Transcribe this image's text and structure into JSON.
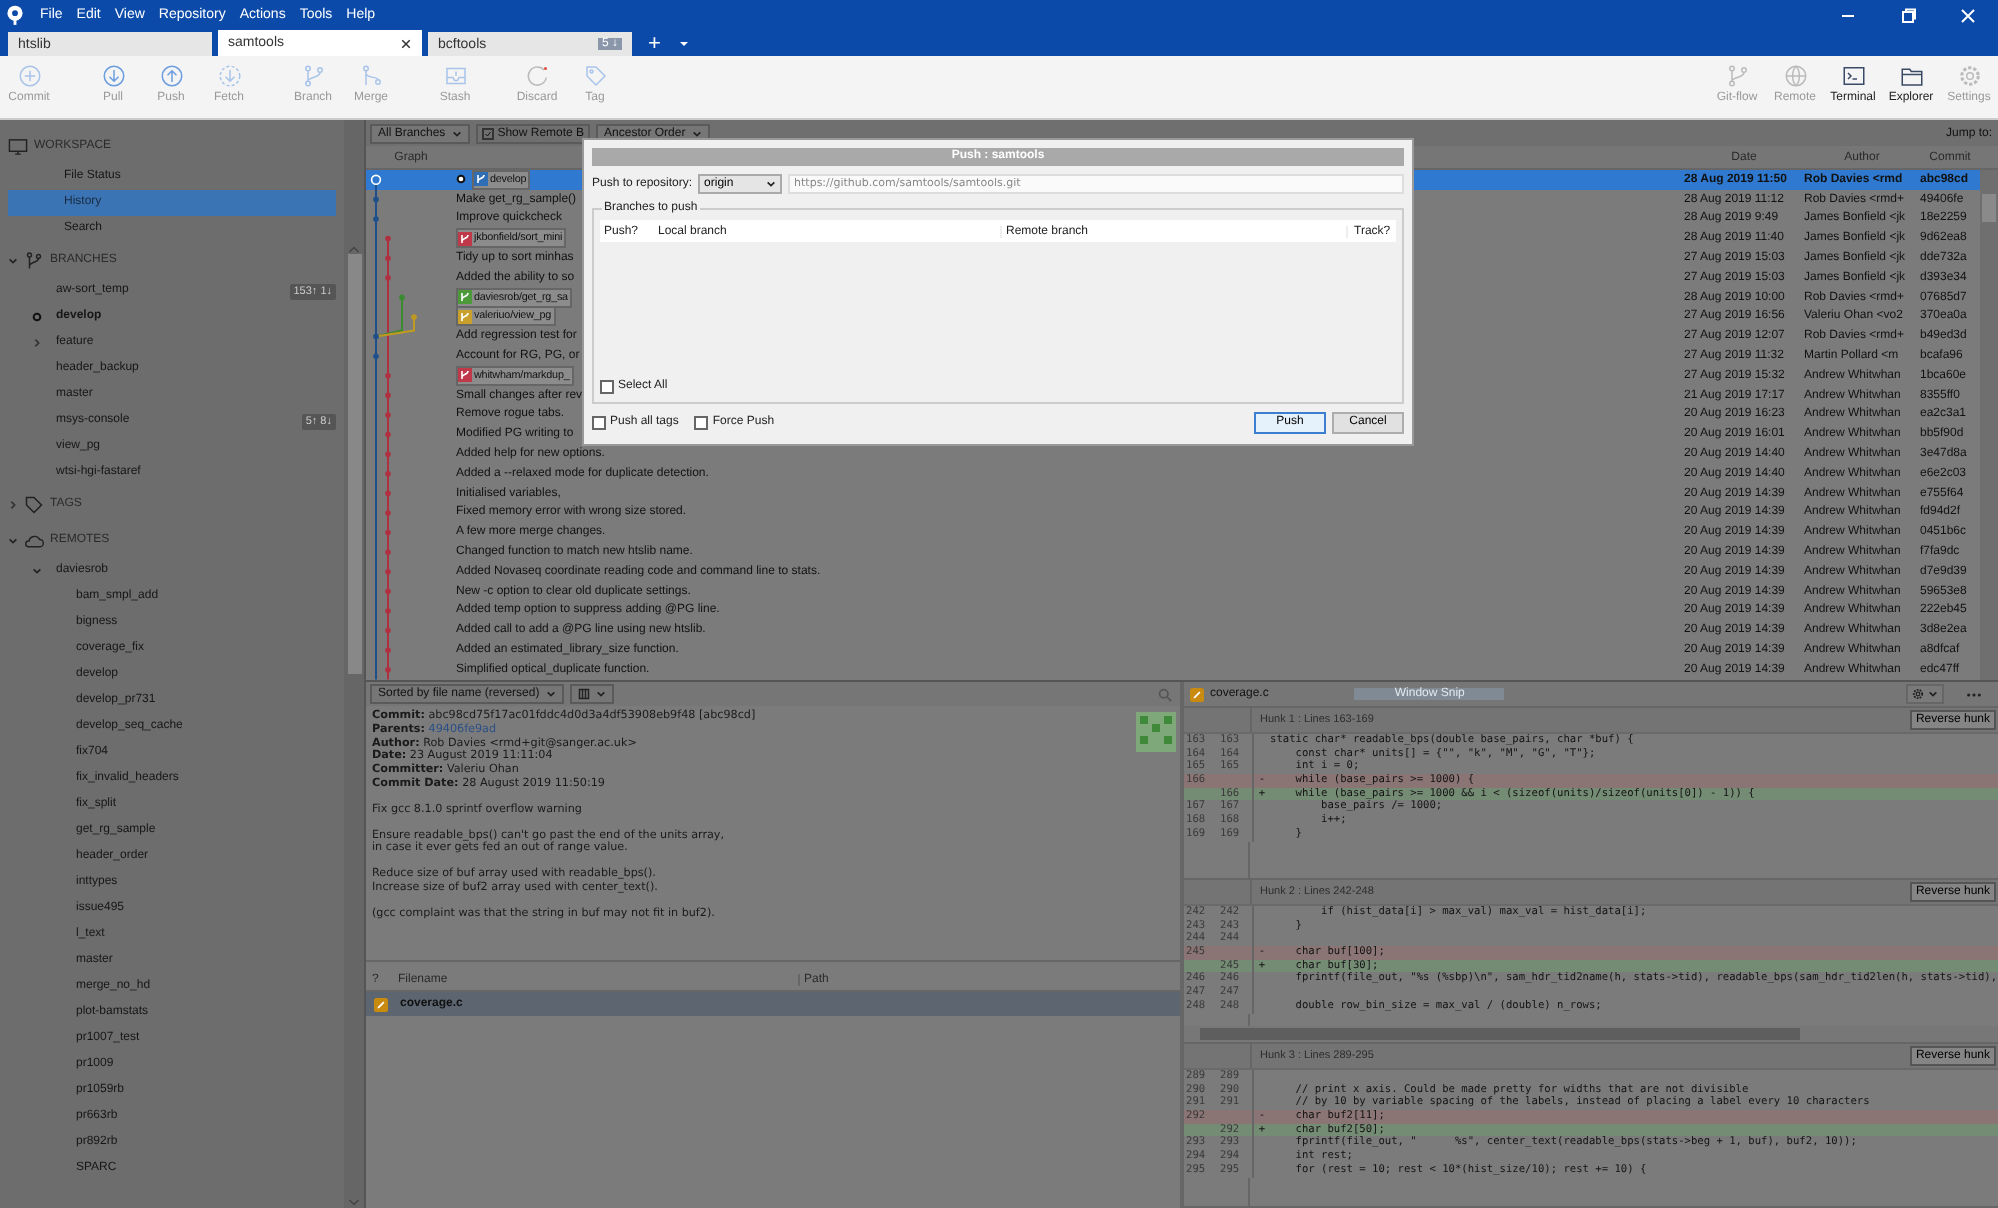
{
  "menu": [
    "File",
    "Edit",
    "View",
    "Repository",
    "Actions",
    "Tools",
    "Help"
  ],
  "tabs": [
    {
      "label": "htslib",
      "selected": false
    },
    {
      "label": "samtools",
      "selected": true
    },
    {
      "label": "bcftools",
      "selected": false,
      "badge": "5 ↓"
    }
  ],
  "new_tab": "+",
  "toolbar": {
    "left": [
      {
        "kind": "commit",
        "label": "Commit"
      },
      {
        "kind": "pull",
        "label": "Pull"
      },
      {
        "kind": "push",
        "label": "Push"
      },
      {
        "kind": "fetch",
        "label": "Fetch"
      },
      {
        "kind": "branch",
        "label": "Branch"
      },
      {
        "kind": "merge",
        "label": "Merge"
      },
      {
        "kind": "stash",
        "label": "Stash"
      },
      {
        "kind": "discard",
        "label": "Discard"
      },
      {
        "kind": "tag",
        "label": "Tag"
      }
    ],
    "right": [
      {
        "kind": "gitflow",
        "label": "Git-flow",
        "enabled": false
      },
      {
        "kind": "remote",
        "label": "Remote",
        "enabled": false
      },
      {
        "kind": "terminal",
        "label": "Terminal",
        "enabled": true
      },
      {
        "kind": "explorer",
        "label": "Explorer",
        "enabled": true
      },
      {
        "kind": "settings",
        "label": "Settings",
        "enabled": false
      }
    ]
  },
  "sidebar": {
    "workspace": {
      "title": "WORKSPACE",
      "items": [
        {
          "label": "File Status",
          "selected": false
        },
        {
          "label": "History",
          "selected": true
        },
        {
          "label": "Search",
          "selected": false
        }
      ]
    },
    "branches": {
      "title": "BRANCHES",
      "expanded": true,
      "items": [
        {
          "kind": "branch",
          "label": "aw-sort_temp",
          "current": false,
          "badge": "153↑ 1↓"
        },
        {
          "kind": "branch",
          "label": "develop",
          "current": true
        },
        {
          "kind": "folder",
          "label": "feature",
          "current": false,
          "expanded": false
        },
        {
          "kind": "branch",
          "label": "header_backup",
          "current": false
        },
        {
          "kind": "branch",
          "label": "master",
          "current": false
        },
        {
          "kind": "branch",
          "label": "msys-console",
          "current": false,
          "badge": "5↑ 8↓"
        },
        {
          "kind": "branch",
          "label": "view_pg",
          "current": false
        },
        {
          "kind": "branch",
          "label": "wtsi-hgi-fastaref",
          "current": false
        }
      ]
    },
    "tags": {
      "title": "TAGS",
      "expanded": false
    },
    "remotes": {
      "title": "REMOTES",
      "expanded": true,
      "children": [
        {
          "label": "daviesrob",
          "expanded": true,
          "children": [
            {
              "label": "bam_smpl_add"
            },
            {
              "label": "bigness"
            },
            {
              "label": "coverage_fix"
            },
            {
              "label": "develop"
            },
            {
              "label": "develop_pr731"
            },
            {
              "label": "develop_seq_cache"
            },
            {
              "label": "fix704"
            },
            {
              "label": "fix_invalid_headers"
            },
            {
              "label": "fix_split"
            },
            {
              "label": "get_rg_sample"
            },
            {
              "label": "header_order"
            },
            {
              "label": "inttypes"
            },
            {
              "label": "issue495"
            },
            {
              "label": "l_text"
            },
            {
              "label": "master"
            },
            {
              "label": "merge_no_hd"
            },
            {
              "label": "plot-bamstats"
            },
            {
              "label": "pr1007_test"
            },
            {
              "label": "pr1009"
            },
            {
              "label": "pr1059rb"
            },
            {
              "label": "pr663rb"
            },
            {
              "label": "pr892rb"
            },
            {
              "label": "SPARC"
            }
          ]
        }
      ]
    }
  },
  "history": {
    "branch_filter": "All Branches",
    "show_remote": {
      "label": "Show Remote B",
      "checked": true
    },
    "order": "Ancestor Order",
    "jump_to": "Jump to:",
    "columns": [
      "Graph",
      "Date",
      "Author",
      "Commit"
    ],
    "rows": [
      {
        "selected": true,
        "head": true,
        "labels": [
          {
            "text": "develop",
            "color": "#2f6db5"
          }
        ],
        "date": "28 Aug 2019 11:50",
        "author": "Rob Davies <rmd",
        "commit": "abc98cd"
      },
      {
        "selected": false,
        "message": "Make get_rg_sample()",
        "date": "28 Aug 2019 11:12",
        "author": "Rob Davies <rmd+",
        "commit": "49406fe"
      },
      {
        "selected": false,
        "message": "Improve quickcheck",
        "date": "28 Aug 2019 9:49",
        "author": "James Bonfield <jk",
        "commit": "18e2259"
      },
      {
        "selected": false,
        "labels": [
          {
            "text": "jkbonfield/sort_mini",
            "color": "#c0394b"
          }
        ],
        "date": "28 Aug 2019 11:40",
        "author": "James Bonfield <jk",
        "commit": "9d62ea8"
      },
      {
        "selected": false,
        "message": "Tidy up to sort minhas",
        "date": "27 Aug 2019 15:03",
        "author": "James Bonfield <jk",
        "commit": "dde732a"
      },
      {
        "selected": false,
        "message": "Added the ability to so",
        "date": "27 Aug 2019 15:03",
        "author": "James Bonfield <jk",
        "commit": "d393e34"
      },
      {
        "selected": false,
        "labels": [
          {
            "text": "daviesrob/get_rg_sa",
            "color": "#4d9a3a"
          }
        ],
        "date": "28 Aug 2019 10:00",
        "author": "Rob Davies <rmd+",
        "commit": "07685d7"
      },
      {
        "selected": false,
        "labels": [
          {
            "text": "valeriuo/view_pg",
            "color": "#c9a02c"
          }
        ],
        "date": "27 Aug 2019 16:56",
        "author": "Valeriu Ohan <vo2",
        "commit": "370ea0a"
      },
      {
        "selected": false,
        "message": "Add regression test for",
        "date": "27 Aug 2019 12:07",
        "author": "Rob Davies <rmd+",
        "commit": "b49ed3d"
      },
      {
        "selected": false,
        "message": "Account for RG, PG, or",
        "date": "27 Aug 2019 11:32",
        "author": "Martin Pollard <m",
        "commit": "bcafa96"
      },
      {
        "selected": false,
        "labels": [
          {
            "text": "whitwham/markdup_",
            "color": "#c0394b"
          }
        ],
        "date": "27 Aug 2019 15:32",
        "author": "Andrew Whitwhan",
        "commit": "1bca60e"
      },
      {
        "selected": false,
        "message": "Small changes after rev",
        "date": "21 Aug 2019 17:17",
        "author": "Andrew Whitwhan",
        "commit": "8355ff0"
      },
      {
        "selected": false,
        "message": "Remove rogue tabs.",
        "date": "20 Aug 2019 16:23",
        "author": "Andrew Whitwhan",
        "commit": "ea2c3a1"
      },
      {
        "selected": false,
        "message": "Modified PG writing to",
        "date": "20 Aug 2019 16:01",
        "author": "Andrew Whitwhan",
        "commit": "bb5f90d"
      },
      {
        "selected": false,
        "message": "Added help for new options.",
        "date": "20 Aug 2019 14:40",
        "author": "Andrew Whitwhan",
        "commit": "3e47d8a"
      },
      {
        "selected": false,
        "message": "Added a --relaxed mode for duplicate detection.",
        "date": "20 Aug 2019 14:40",
        "author": "Andrew Whitwhan",
        "commit": "e6e2c03"
      },
      {
        "selected": false,
        "message": "Initialised variables,",
        "date": "20 Aug 2019 14:39",
        "author": "Andrew Whitwhan",
        "commit": "e755f64"
      },
      {
        "selected": false,
        "message": "Fixed memory error with wrong size stored.",
        "date": "20 Aug 2019 14:39",
        "author": "Andrew Whitwhan",
        "commit": "fd94d2f"
      },
      {
        "selected": false,
        "message": "A few more merge changes.",
        "date": "20 Aug 2019 14:39",
        "author": "Andrew Whitwhan",
        "commit": "0451b6c"
      },
      {
        "selected": false,
        "message": "Changed function to match new htslib name.",
        "date": "20 Aug 2019 14:39",
        "author": "Andrew Whitwhan",
        "commit": "f7fa9dc"
      },
      {
        "selected": false,
        "message": "Added Novaseq coordinate reading code and command line to stats.",
        "date": "20 Aug 2019 14:39",
        "author": "Andrew Whitwhan",
        "commit": "d7e9d39"
      },
      {
        "selected": false,
        "message": "New -c option to clear old duplicate settings.",
        "date": "20 Aug 2019 14:39",
        "author": "Andrew Whitwhan",
        "commit": "59653e8"
      },
      {
        "selected": false,
        "message": "Added temp option to suppress adding @PG line.",
        "date": "20 Aug 2019 14:39",
        "author": "Andrew Whitwhan",
        "commit": "222eb45"
      },
      {
        "selected": false,
        "message": "Added call to add a @PG line using new htslib.",
        "date": "20 Aug 2019 14:39",
        "author": "Andrew Whitwhan",
        "commit": "3d8e2ea"
      },
      {
        "selected": false,
        "message": "Added an estimated_library_size function.",
        "date": "20 Aug 2019 14:39",
        "author": "Andrew Whitwhan",
        "commit": "a8dfcaf"
      },
      {
        "selected": false,
        "message": "Simplified optical_duplicate function.",
        "date": "20 Aug 2019 14:39",
        "author": "Andrew Whitwhan",
        "commit": "edc47ff"
      }
    ]
  },
  "details": {
    "sort": "Sorted by file name (reversed)",
    "fields": [
      {
        "kind": "text",
        "label": "Commit:",
        "value": "abc98cd75f17ac01fddc4d0d3a4df53908eb9f48 [abc98cd]"
      },
      {
        "kind": "link",
        "label": "Parents:",
        "value": "49406fe9ad"
      },
      {
        "kind": "text",
        "label": "Author:",
        "value": "Rob Davies <rmd+git@sanger.ac.uk>"
      },
      {
        "kind": "text",
        "label": "Date:",
        "value": "23 August 2019 11:11:04"
      },
      {
        "kind": "text",
        "label": "Committer:",
        "value": "Valeriu Ohan"
      },
      {
        "kind": "text",
        "label": "Commit Date:",
        "value": "28 August 2019 11:50:19"
      }
    ],
    "message": [
      "Fix gcc 8.1.0 sprintf overflow warning",
      "Ensure readable_bps() can't go past the end of the units array,\nin case it ever gets fed an out of range value.",
      "Reduce size of buf array used with readable_bps().\nIncrease size of buf2 array used with center_text().",
      "(gcc complaint was that the string in buf may not fit in buf2)."
    ],
    "files": {
      "columns": [
        "?",
        "Filename",
        "Path"
      ],
      "rows": [
        {
          "name": "coverage.c",
          "selected": true
        }
      ]
    }
  },
  "diff": {
    "file": "coverage.c",
    "snip_hint": "Window Snip",
    "hunks": [
      {
        "title": "Hunk 1 : Lines 163-169",
        "button": "Reverse hunk",
        "h_scroll": false,
        "lines": [
          {
            "kind": "context",
            "old": "163",
            "new": "163",
            "code": "static char* readable_bps(double base_pairs, char *buf) {"
          },
          {
            "kind": "context",
            "old": "164",
            "new": "164",
            "code": "    const char* units[] = {\"\", \"k\", \"M\", \"G\", \"T\"};"
          },
          {
            "kind": "context",
            "old": "165",
            "new": "165",
            "code": "    int i = 0;"
          },
          {
            "kind": "removed",
            "old": "166",
            "sign": "-",
            "code": "    while (base_pairs >= 1000) {"
          },
          {
            "kind": "added",
            "new": "166",
            "sign": "+",
            "code": "    while (base_pairs >= 1000 && i < (sizeof(units)/sizeof(units[0]) - 1)) {"
          },
          {
            "kind": "context",
            "old": "167",
            "new": "167",
            "code": "        base_pairs /= 1000;"
          },
          {
            "kind": "context",
            "old": "168",
            "new": "168",
            "code": "        i++;"
          },
          {
            "kind": "context",
            "old": "169",
            "new": "169",
            "code": "    }"
          }
        ]
      },
      {
        "title": "Hunk 2 : Lines 242-248",
        "button": "Reverse hunk",
        "h_scroll": true,
        "lines": [
          {
            "kind": "context",
            "old": "242",
            "new": "242",
            "code": "        if (hist_data[i] > max_val) max_val = hist_data[i];"
          },
          {
            "kind": "context",
            "old": "243",
            "new": "243",
            "code": "    }"
          },
          {
            "kind": "context",
            "old": "244",
            "new": "244"
          },
          {
            "kind": "removed",
            "old": "245",
            "sign": "-",
            "code": "    char buf[100];"
          },
          {
            "kind": "added",
            "new": "245",
            "sign": "+",
            "code": "    char buf[30];"
          },
          {
            "kind": "context",
            "old": "246",
            "new": "246",
            "code": "    fprintf(file_out, \"%s (%sbp)\\n\", sam_hdr_tid2name(h, stats->tid), readable_bps(sam_hdr_tid2len(h, stats->tid),"
          },
          {
            "kind": "context",
            "old": "247",
            "new": "247"
          },
          {
            "kind": "context",
            "old": "248",
            "new": "248",
            "code": "    double row_bin_size = max_val / (double) n_rows;"
          }
        ]
      },
      {
        "title": "Hunk 3 : Lines 289-295",
        "button": "Reverse hunk",
        "h_scroll": false,
        "lines": [
          {
            "kind": "context",
            "old": "289",
            "new": "289"
          },
          {
            "kind": "context",
            "old": "290",
            "new": "290",
            "code": "    // print x axis. Could be made pretty for widths that are not divisible"
          },
          {
            "kind": "context",
            "old": "291",
            "new": "291",
            "code": "    // by 10 by variable spacing of the labels, instead of placing a label every 10 characters"
          },
          {
            "kind": "removed",
            "old": "292",
            "sign": "-",
            "code": "    char buf2[11];"
          },
          {
            "kind": "added",
            "new": "292",
            "sign": "+",
            "code": "    char buf2[50];"
          },
          {
            "kind": "context",
            "old": "293",
            "new": "293",
            "code": "    fprintf(file_out, \"      %s\", center_text(readable_bps(stats->beg + 1, buf), buf2, 10));"
          },
          {
            "kind": "context",
            "old": "294",
            "new": "294",
            "code": "    int rest;"
          },
          {
            "kind": "context",
            "old": "295",
            "new": "295",
            "code": "    for (rest = 10; rest < 10*(hist_size/10); rest += 10) {"
          }
        ]
      }
    ]
  },
  "dialog": {
    "title": "Push : samtools",
    "repo_label": "Push to repository:",
    "remote": "origin",
    "url": "https://github.com/samtools/samtools.git",
    "group": "Branches to push",
    "columns": [
      "Push?",
      "Local branch",
      "Remote branch",
      "Track?"
    ],
    "select_all": {
      "label": "Select All",
      "checked": false
    },
    "options": [
      {
        "label": "Push all tags",
        "checked": false
      },
      {
        "label": "Force Push",
        "checked": false
      }
    ],
    "buttons": [
      {
        "label": "Push",
        "default": true
      },
      {
        "label": "Cancel",
        "default": false
      }
    ]
  }
}
